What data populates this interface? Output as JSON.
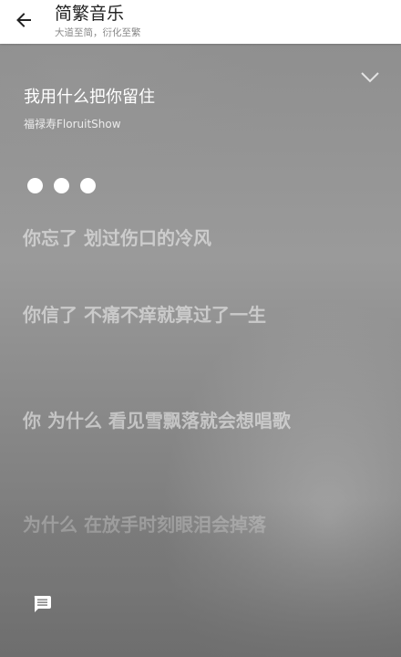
{
  "header": {
    "app_title": "简繁音乐",
    "app_subtitle": "大道至简，衍化至繁",
    "back_icon": "arrow-left-icon"
  },
  "player": {
    "collapse_icon": "chevron-down-icon",
    "song_title": "我用什么把你留住",
    "artist": "福禄寿FloruitShow",
    "loading_indicator": "three-dots",
    "lyrics": [
      "你忘了 划过伤口的冷风",
      "你信了 不痛不痒就算过了一生",
      "你 为什么 看见雪飘落就会想唱歌",
      "为什么 在放手时刻眼泪会掉落"
    ],
    "comment_icon": "comment-icon"
  },
  "colors": {
    "header_background": "#ffffff",
    "header_title": "#222222",
    "header_subtitle": "#888888",
    "player_background": "#8f8f8f",
    "lyric_text": "#ffffff"
  }
}
